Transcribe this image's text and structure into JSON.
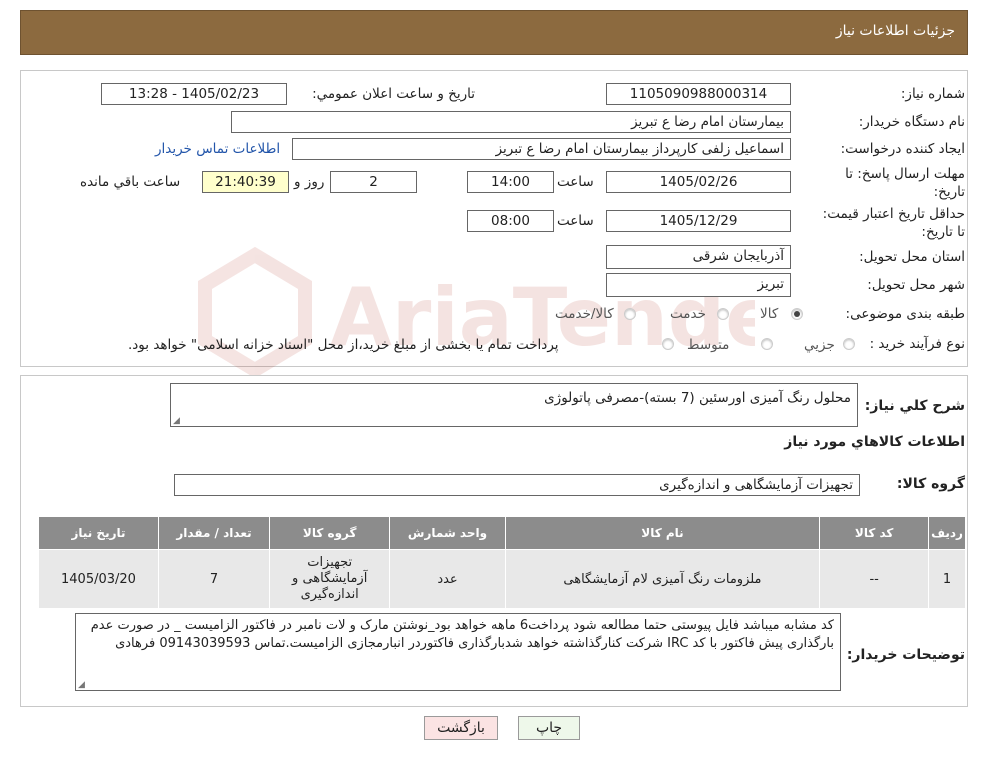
{
  "header": {
    "title": "جزئیات اطلاعات نیاز"
  },
  "form": {
    "need_number_label": "شماره نیاز:",
    "need_number": "1105090988000314",
    "announce_label": "تاریخ و ساعت اعلان عمومي:",
    "announce_value": "1405/02/23 - 13:28",
    "buyer_org_label": "نام دستگاه خریدار:",
    "buyer_org": "بیمارستان امام رضا  ع  تبریز",
    "creator_label": "ایجاد کننده درخواست:",
    "creator": "اسماعیل زلفی کارپرداز بیمارستان امام رضا  ع  تبریز",
    "contact_link": "اطلاعات تماس خریدار",
    "deadline_label": "مهلت ارسال پاسخ: تا تاریخ:",
    "deadline_date": "1405/02/26",
    "time_label": "ساعت",
    "deadline_time": "14:00",
    "days": "2",
    "days_label": "روز و",
    "remaining": "21:40:39",
    "remaining_label": "ساعت باقي مانده",
    "validity_label": "حداقل تاریخ اعتبار قیمت: تا تاریخ:",
    "validity_date": "1405/12/29",
    "validity_time": "08:00",
    "province_label": "استان محل تحویل:",
    "province": "آذربایجان شرقی",
    "city_label": "شهر محل تحویل:",
    "city": "تبریز",
    "category_label": "طبقه بندی موضوعی:",
    "category_options": [
      "کالا",
      "خدمت",
      "کالا/خدمت"
    ],
    "process_label": "نوع فرآیند خرید :",
    "process_options": [
      "جزیي",
      "متوسط"
    ],
    "process_note": "پرداخت تمام یا بخشی از مبلغ خرید،از محل \"اسناد خزانه اسلامی\" خواهد بود."
  },
  "details": {
    "desc_label": "شرح کلي نیاز:",
    "desc": "محلول رنگ آمیزی اورسئین (7 بسته)-مصرفی پاتولوژی",
    "goods_info_title": "اطلاعات کالاهاي مورد نیاز",
    "group_label": "گروه کالا:",
    "group_value": "تجهیزات آزمایشگاهی و اندازه‌گیری"
  },
  "table": {
    "headers": [
      "ردیف",
      "کد کالا",
      "نام کالا",
      "واحد شمارش",
      "گروه کالا",
      "تعداد / مقدار",
      "تاریخ نیاز"
    ],
    "rows": [
      {
        "row": "1",
        "code": "--",
        "name": "ملزومات رنگ آمیزی لام آزمایشگاهی",
        "unit": "عدد",
        "group": "تجهیزات آزمایشگاهی و اندازه‌گیری",
        "qty": "7",
        "date": "1405/03/20"
      }
    ]
  },
  "buyer_notes": {
    "label": "توضیحات خریدار:",
    "text": "کد مشابه میباشد فایل پیوستی حتما مطالعه شود  پرداخت6 ماهه خواهد بود_نوشتن مارک و لات نامبر در فاکتور الزامیست _  در صورت عدم بارگذاری پیش فاکتور با کد IRC  شرکت کنارگذاشته خواهد شدبارگذاری فاکتوردر انبارمجازی الزامیست.تماس 09143039593 فرهادی"
  },
  "buttons": {
    "print": "چاپ",
    "back": "بازگشت"
  },
  "colors": {
    "header_bg": "#8c6a3f",
    "table_header": "#8c8c8c",
    "yellow_box": "#ffffcc"
  }
}
